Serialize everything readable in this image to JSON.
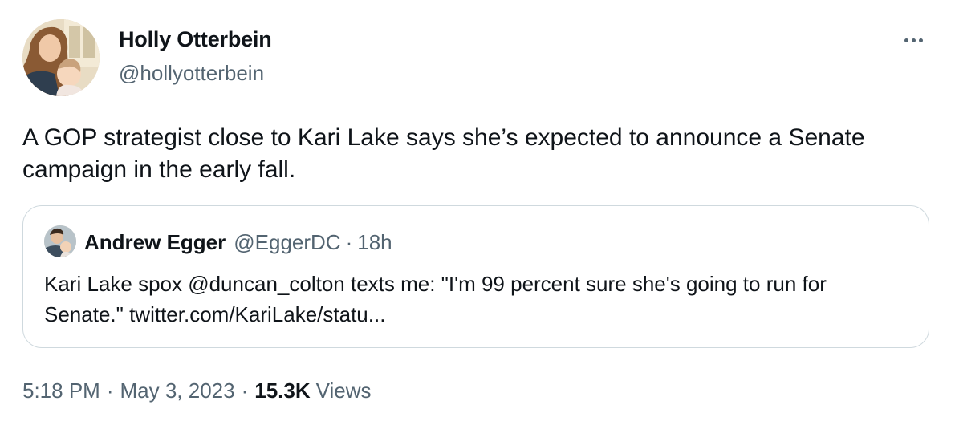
{
  "author": {
    "display_name": "Holly Otterbein",
    "handle": "@hollyotterbein"
  },
  "tweet": {
    "text": "A GOP strategist close to Kari Lake says she’s expected to announce a Senate campaign in the early fall."
  },
  "quoted_tweet": {
    "display_name": "Andrew Egger",
    "handle": "@EggerDC",
    "separator": "·",
    "time": "18h",
    "text": "Kari Lake spox @duncan_colton texts me: \"I'm 99 percent sure she's going to run for Senate.\" twitter.com/KariLake/statu..."
  },
  "meta": {
    "time": "5:18 PM",
    "separator": "·",
    "date": "May 3, 2023",
    "views_count": "15.3K",
    "views_label": "Views"
  },
  "icons": {
    "more": "more-horizontal-icon"
  },
  "colors": {
    "text_primary": "#0f1419",
    "text_secondary": "#536471",
    "border": "#cfd9de"
  }
}
